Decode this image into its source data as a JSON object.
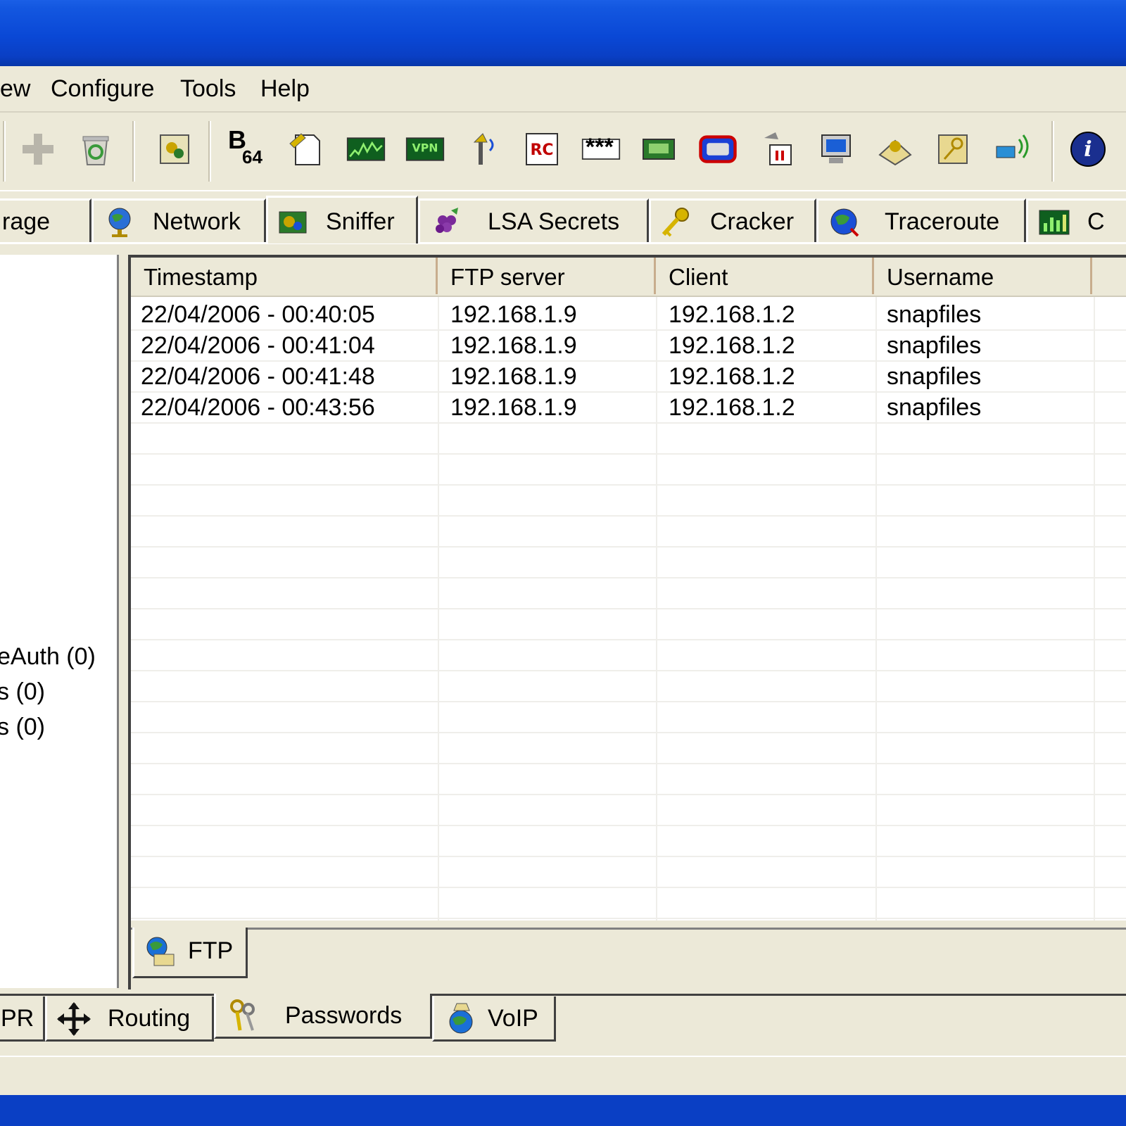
{
  "menu": {
    "items": [
      "ew",
      "Configure",
      "Tools",
      "Help"
    ]
  },
  "toolbar": {
    "icons": [
      "separator-edge",
      "add-icon",
      "recycle-icon",
      "network-card-icon",
      "base64-icon",
      "hash-calculator-icon",
      "sniffer-graph-icon",
      "vpn-icon",
      "wireless-icon",
      "rsa-icon",
      "password-dots-icon",
      "scanner-icon",
      "routing-table-icon",
      "tools-icon",
      "computer-icon",
      "keyboard-icon",
      "key-card-icon",
      "wireless-network-icon",
      "info-icon"
    ],
    "base64_label": "B",
    "base64_sub": "64",
    "stars_label": "***",
    "vpn_label": "VPN"
  },
  "top_tabs": [
    {
      "label": "rage",
      "icon": "drive-icon"
    },
    {
      "label": "Network",
      "icon": "globe-icon"
    },
    {
      "label": "Sniffer",
      "icon": "sniffer-icon",
      "active": true
    },
    {
      "label": "LSA Secrets",
      "icon": "grapes-icon"
    },
    {
      "label": "Cracker",
      "icon": "key-icon"
    },
    {
      "label": "Traceroute",
      "icon": "globe-trace-icon"
    },
    {
      "label": "C",
      "icon": "chart-icon"
    }
  ],
  "left_tree": {
    "items": [
      "eAuth (0)",
      "s (0)",
      "s (0)"
    ]
  },
  "table": {
    "columns": [
      "Timestamp",
      "FTP server",
      "Client",
      "Username"
    ],
    "rows": [
      [
        "22/04/2006 - 00:40:05",
        "192.168.1.9",
        "192.168.1.2",
        "snapfiles"
      ],
      [
        "22/04/2006 - 00:41:04",
        "192.168.1.9",
        "192.168.1.2",
        "snapfiles"
      ],
      [
        "22/04/2006 - 00:41:48",
        "192.168.1.9",
        "192.168.1.2",
        "snapfiles"
      ],
      [
        "22/04/2006 - 00:43:56",
        "192.168.1.9",
        "192.168.1.2",
        "snapfiles"
      ]
    ]
  },
  "sub_tabs": [
    {
      "label": "FTP",
      "icon": "ftp-icon",
      "active": true
    }
  ],
  "bottom_tabs": [
    {
      "label": "PR",
      "icon": ""
    },
    {
      "label": "Routing",
      "icon": "move-arrows-icon"
    },
    {
      "label": "Passwords",
      "icon": "keys-icon",
      "active": true
    },
    {
      "label": "VoIP",
      "icon": "voip-icon"
    }
  ],
  "colors": {
    "titlebar": "#0a48d6",
    "window_bg": "#ece9d8",
    "header_divider": "#c8ad8d"
  }
}
